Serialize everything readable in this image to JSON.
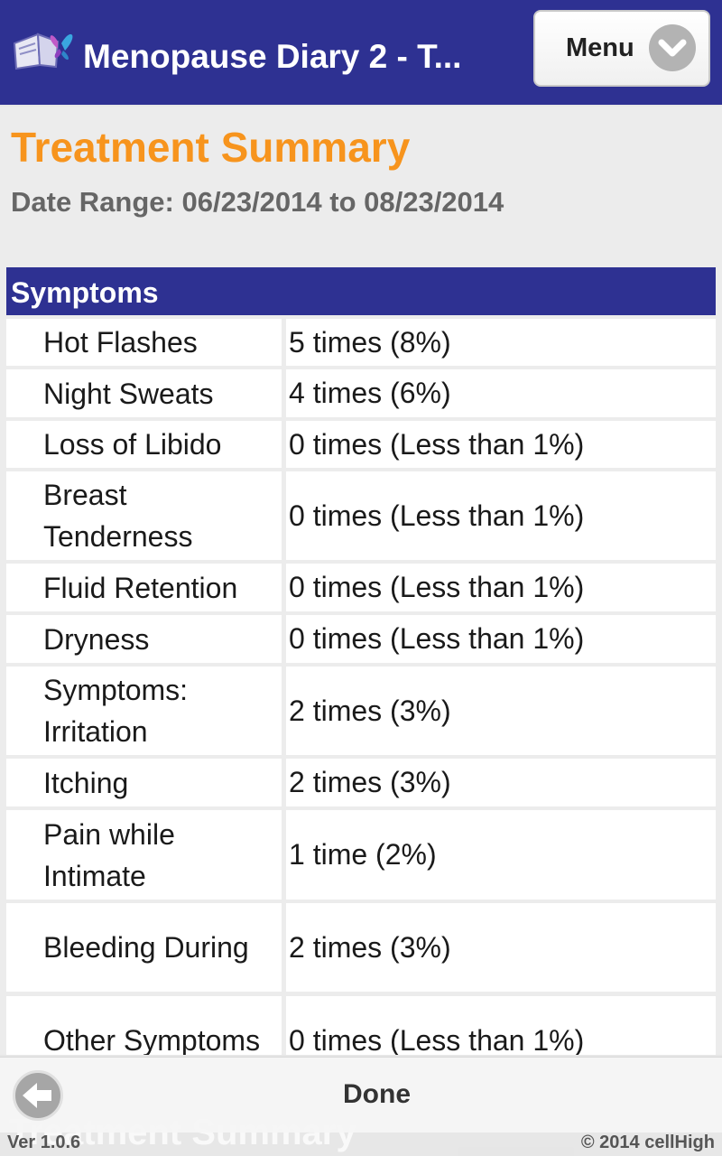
{
  "header": {
    "title": "Menopause Diary 2 - T...",
    "menu_label": "Menu",
    "bg_color": "#2e3192"
  },
  "page": {
    "title": "Treatment Summary",
    "title_color": "#f7941d",
    "date_range": "Date Range: 06/23/2014 to 08/23/2014"
  },
  "section": {
    "title": "Symptoms"
  },
  "rows": [
    {
      "label": "Hot Flashes",
      "value": "5 times (8%)"
    },
    {
      "label": "Night Sweats",
      "value": "4 times (6%)"
    },
    {
      "label": "Loss of Libido",
      "value": "0 times (Less than 1%)"
    },
    {
      "label": "Breast Tenderness",
      "value": "0 times (Less than 1%)"
    },
    {
      "label": "Fluid Retention",
      "value": "0 times (Less than 1%)"
    },
    {
      "label": "Dryness",
      "value": "0 times (Less than 1%)"
    },
    {
      "label": "Symptoms: Irritation",
      "value": "2 times (3%)"
    },
    {
      "label": "Itching",
      "value": "2 times (3%)"
    },
    {
      "label": "Pain while Intimate",
      "value": "1 time (2%)"
    },
    {
      "label": "Bleeding During",
      "value": "2 times (3%)"
    },
    {
      "label": "Other Symptoms",
      "value": "0 times (Less than 1%)"
    }
  ],
  "footer": {
    "done_label": "Done",
    "ghost_title": "Treatment Summary",
    "version": "Ver 1.0.6",
    "copyright": "© 2014 cellHigh"
  },
  "icons": {
    "app": "book-butterfly-icon",
    "menu": "chevron-down-icon",
    "back": "arrow-left-icon"
  }
}
